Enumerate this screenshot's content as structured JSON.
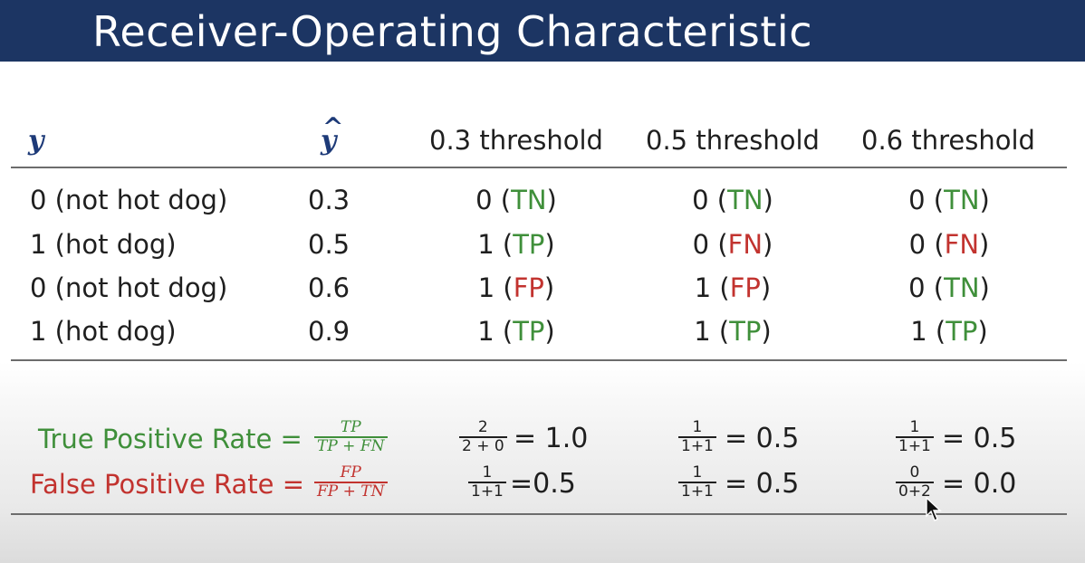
{
  "slide": {
    "title": "Receiver-Operating Characteristic"
  },
  "table": {
    "headers": {
      "y": "y",
      "yhat": "y",
      "t03": "0.3 threshold",
      "t05": "0.5 threshold",
      "t06": "0.6 threshold"
    },
    "rows": [
      {
        "label": "0 (not hot dog)",
        "score": "0.3",
        "t03": {
          "pred": "0 (",
          "tag": "TN",
          "close": ")",
          "color": "#3f8f3a"
        },
        "t05": {
          "pred": "0 (",
          "tag": "TN",
          "close": ")",
          "color": "#3f8f3a"
        },
        "t06": {
          "pred": "0 (",
          "tag": "TN",
          "close": ")",
          "color": "#3f8f3a"
        }
      },
      {
        "label": "1 (hot dog)",
        "score": "0.5",
        "t03": {
          "pred": "1 (",
          "tag": "TP",
          "close": ")",
          "color": "#3f8f3a"
        },
        "t05": {
          "pred": "0 (",
          "tag": "FN",
          "close": ")",
          "color": "#c2332f"
        },
        "t06": {
          "pred": "0 (",
          "tag": "FN",
          "close": ")",
          "color": "#c2332f"
        }
      },
      {
        "label": "0 (not hot dog)",
        "score": "0.6",
        "t03": {
          "pred": "1 (",
          "tag": "FP",
          "close": ")",
          "color": "#c2332f"
        },
        "t05": {
          "pred": "1 (",
          "tag": "FP",
          "close": ")",
          "color": "#c2332f"
        },
        "t06": {
          "pred": "0 (",
          "tag": "TN",
          "close": ")",
          "color": "#3f8f3a"
        }
      },
      {
        "label": "1 (hot dog)",
        "score": "0.9",
        "t03": {
          "pred": "1 (",
          "tag": "TP",
          "close": ")",
          "color": "#3f8f3a"
        },
        "t05": {
          "pred": "1 (",
          "tag": "TP",
          "close": ")",
          "color": "#3f8f3a"
        },
        "t06": {
          "pred": "1 (",
          "tag": "TP",
          "close": ")",
          "color": "#3f8f3a"
        }
      }
    ]
  },
  "rates": {
    "tpr": {
      "label": "True Positive Rate =",
      "formula_num": "TP",
      "formula_den": "TP + FN",
      "color": "#3f8f3a",
      "values": [
        {
          "num": "2",
          "den": "2 + 0",
          "result": "= 1.0"
        },
        {
          "num": "1",
          "den": "1+1",
          "result": "= 0.5"
        },
        {
          "num": "1",
          "den": "1+1",
          "result": "= 0.5"
        }
      ]
    },
    "fpr": {
      "label": "False Positive Rate =",
      "formula_num": "FP",
      "formula_den": "FP + TN",
      "color": "#c2332f",
      "values": [
        {
          "num": "1",
          "den": "1+1",
          "result": "=0.5"
        },
        {
          "num": "1",
          "den": "1+1",
          "result": "= 0.5"
        },
        {
          "num": "0",
          "den": "0+2",
          "result": "= 0.0"
        }
      ]
    }
  },
  "icons": {
    "cursor": "mouse-pointer-icon"
  }
}
